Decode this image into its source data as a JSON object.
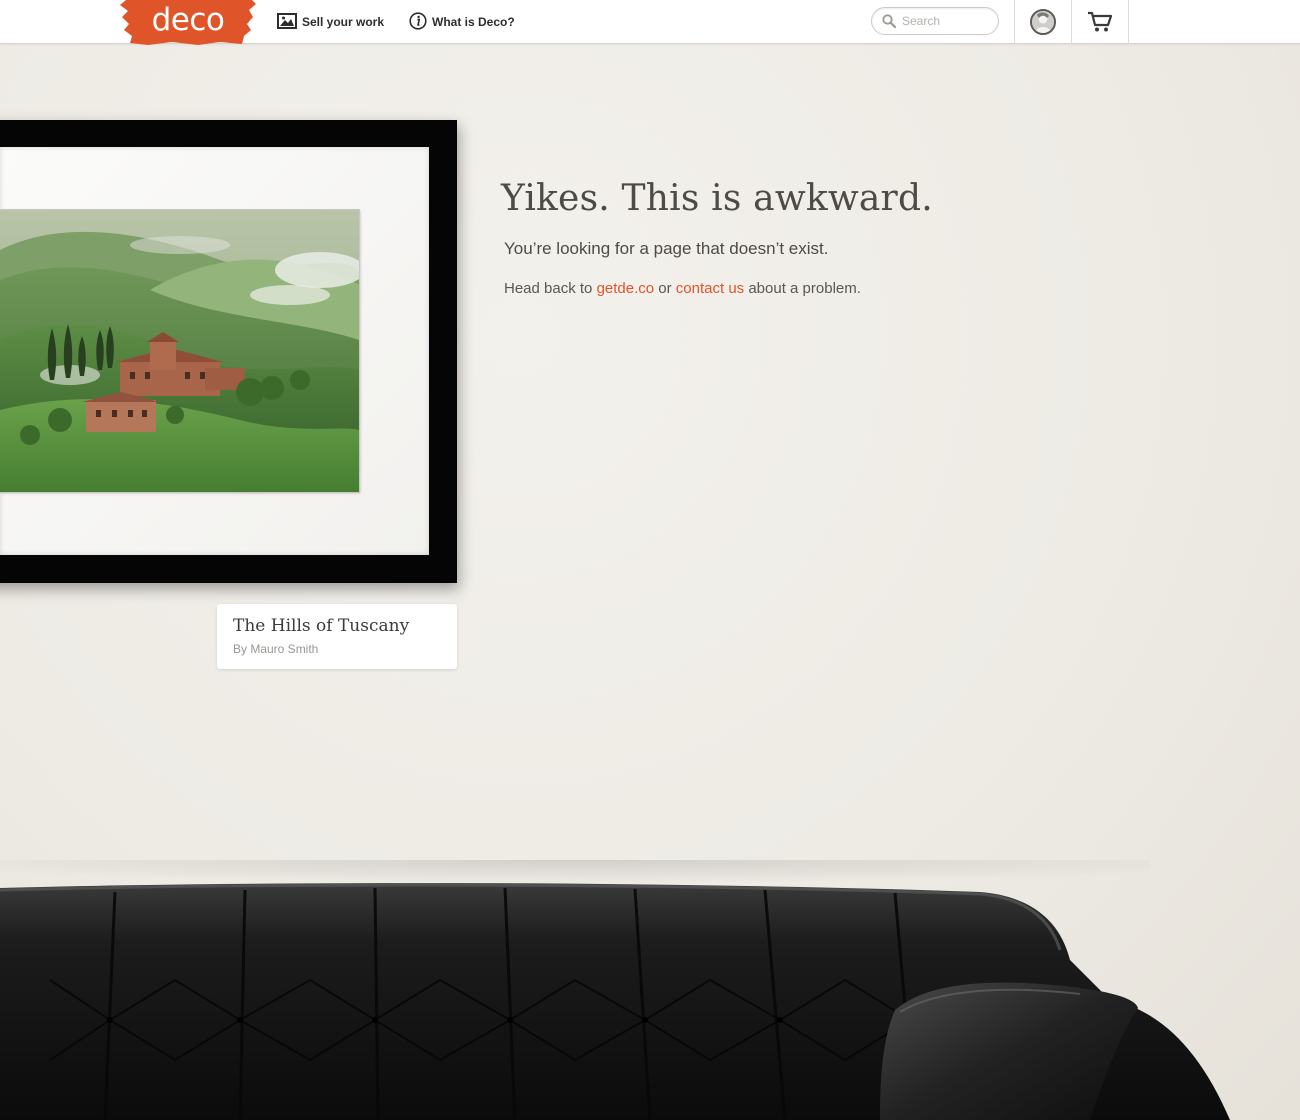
{
  "header": {
    "logo_text": "deco",
    "brand_color": "#e0542a",
    "nav": [
      {
        "label": "Sell your work",
        "icon": "image-icon"
      },
      {
        "label": "What is Deco?",
        "icon": "info-icon"
      }
    ],
    "search": {
      "placeholder": "Search",
      "value": ""
    },
    "avatar_icon": "user-avatar",
    "cart_icon": "cart-icon"
  },
  "artwork": {
    "title": "The Hills of Tuscany",
    "artist": "By Mauro Smith"
  },
  "message": {
    "headline": "Yikes. This is awkward.",
    "subline": "You’re looking for a page that doesn’t exist.",
    "help_prefix": "Head back to",
    "home_link": "getde.co",
    "help_middle": "or",
    "contact_link": "contact us",
    "help_suffix": "about a problem."
  }
}
